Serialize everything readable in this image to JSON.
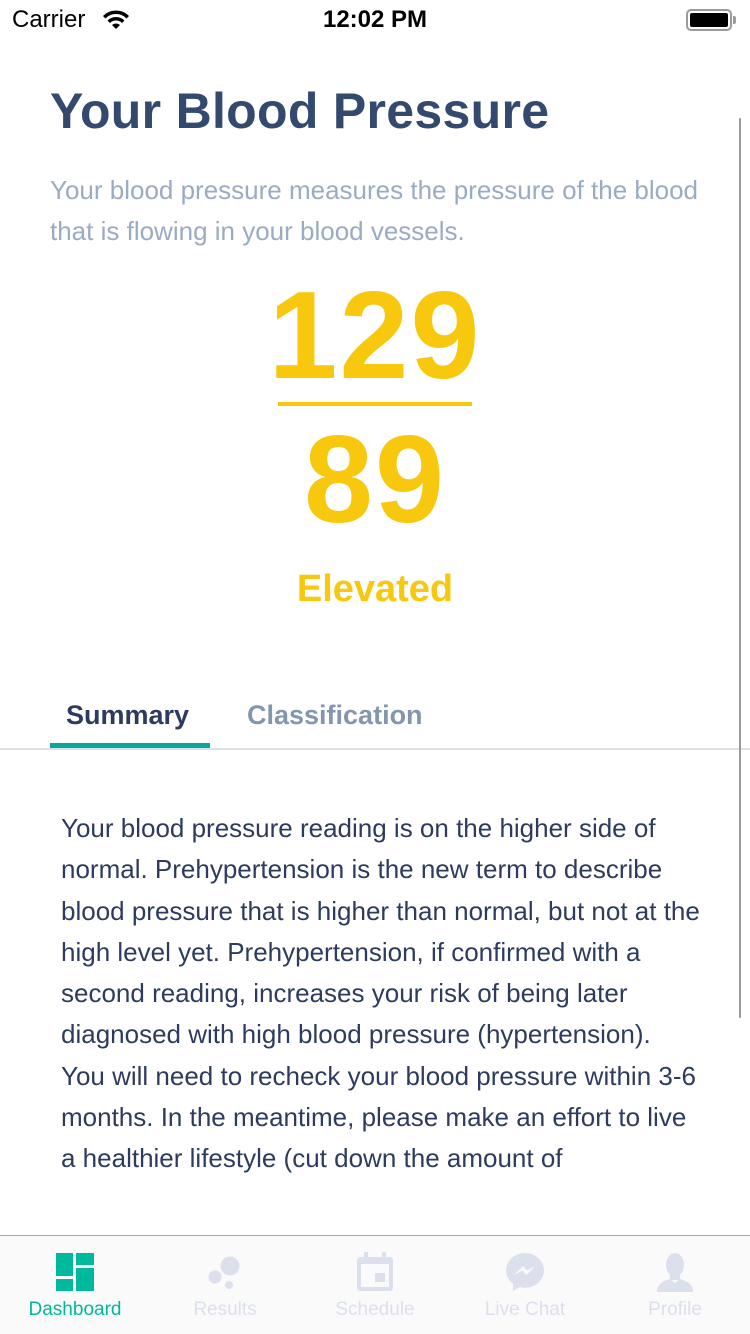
{
  "status_bar": {
    "carrier": "Carrier",
    "time": "12:02 PM",
    "wifi_icon": "wifi-icon",
    "battery_icon": "battery-full-icon"
  },
  "header": {
    "title": "Your Blood Pressure",
    "subtitle": "Your blood pressure measures the pressure of the blood that is flowing in your blood vessels."
  },
  "reading": {
    "systolic": "129",
    "diastolic": "89",
    "category": "Elevated",
    "accent_color": "#F8C80E"
  },
  "tabs": {
    "items": [
      {
        "label": "Summary",
        "active": true
      },
      {
        "label": "Classification",
        "active": false
      }
    ],
    "indicator_color": "#05A99A"
  },
  "content": {
    "summary_text": "Your blood pressure reading is on the higher side of normal. Prehypertension is the new term to describe blood pressure that is higher than normal, but not at the high level yet. Prehypertension, if confirmed with a second reading, increases your risk of being later diagnosed with high blood pressure (hypertension). You will need to recheck your blood pressure within 3-6 months. In the meantime, please make an effort to live a healthier lifestyle (cut down the amount of"
  },
  "tab_bar": {
    "active_color": "#00B89C",
    "inactive_color": "#DCE0EC",
    "items": [
      {
        "label": "Dashboard",
        "icon": "dashboard-icon",
        "active": true
      },
      {
        "label": "Results",
        "icon": "results-bubbles-icon",
        "active": false
      },
      {
        "label": "Schedule",
        "icon": "calendar-icon",
        "active": false
      },
      {
        "label": "Live Chat",
        "icon": "messenger-chat-icon",
        "active": false
      },
      {
        "label": "Profile",
        "icon": "user-profile-icon",
        "active": false
      }
    ]
  }
}
